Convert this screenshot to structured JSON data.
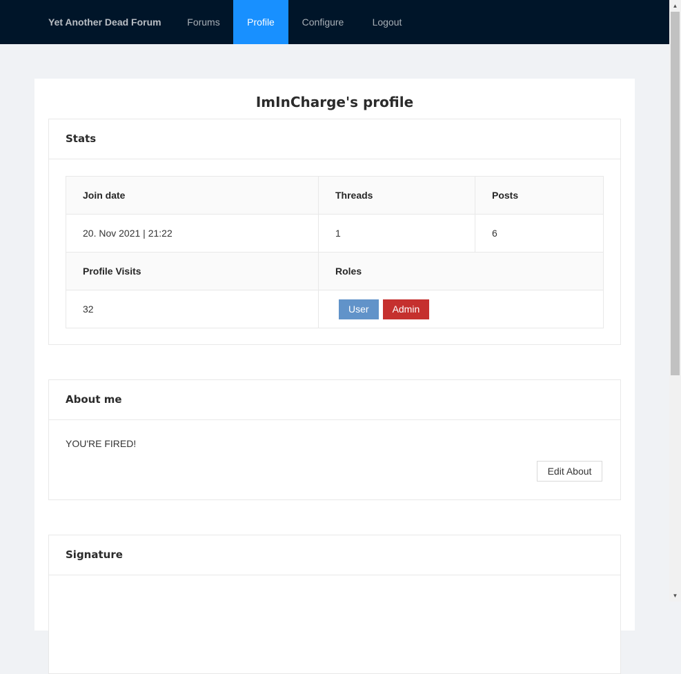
{
  "nav": {
    "brand": "Yet Another Dead Forum",
    "items": [
      {
        "label": "Forums",
        "active": false
      },
      {
        "label": "Profile",
        "active": true
      },
      {
        "label": "Configure",
        "active": false
      },
      {
        "label": "Logout",
        "active": false
      }
    ]
  },
  "page": {
    "title": "ImInCharge's profile"
  },
  "stats": {
    "header": "Stats",
    "join_date_label": "Join date",
    "threads_label": "Threads",
    "posts_label": "Posts",
    "join_date": "20. Nov 2021 | 21:22",
    "threads": "1",
    "posts": "6",
    "visits_label": "Profile Visits",
    "roles_label": "Roles",
    "visits": "32",
    "roles": [
      {
        "label": "User",
        "color": "#6193c9"
      },
      {
        "label": "Admin",
        "color": "#c5302e"
      }
    ]
  },
  "about": {
    "header": "About me",
    "text": "YOU'RE FIRED!",
    "edit_label": "Edit About"
  },
  "signature": {
    "header": "Signature"
  },
  "colors": {
    "navbar": "#001529",
    "active_nav": "#1890ff",
    "page_bg": "#f0f2f5"
  }
}
